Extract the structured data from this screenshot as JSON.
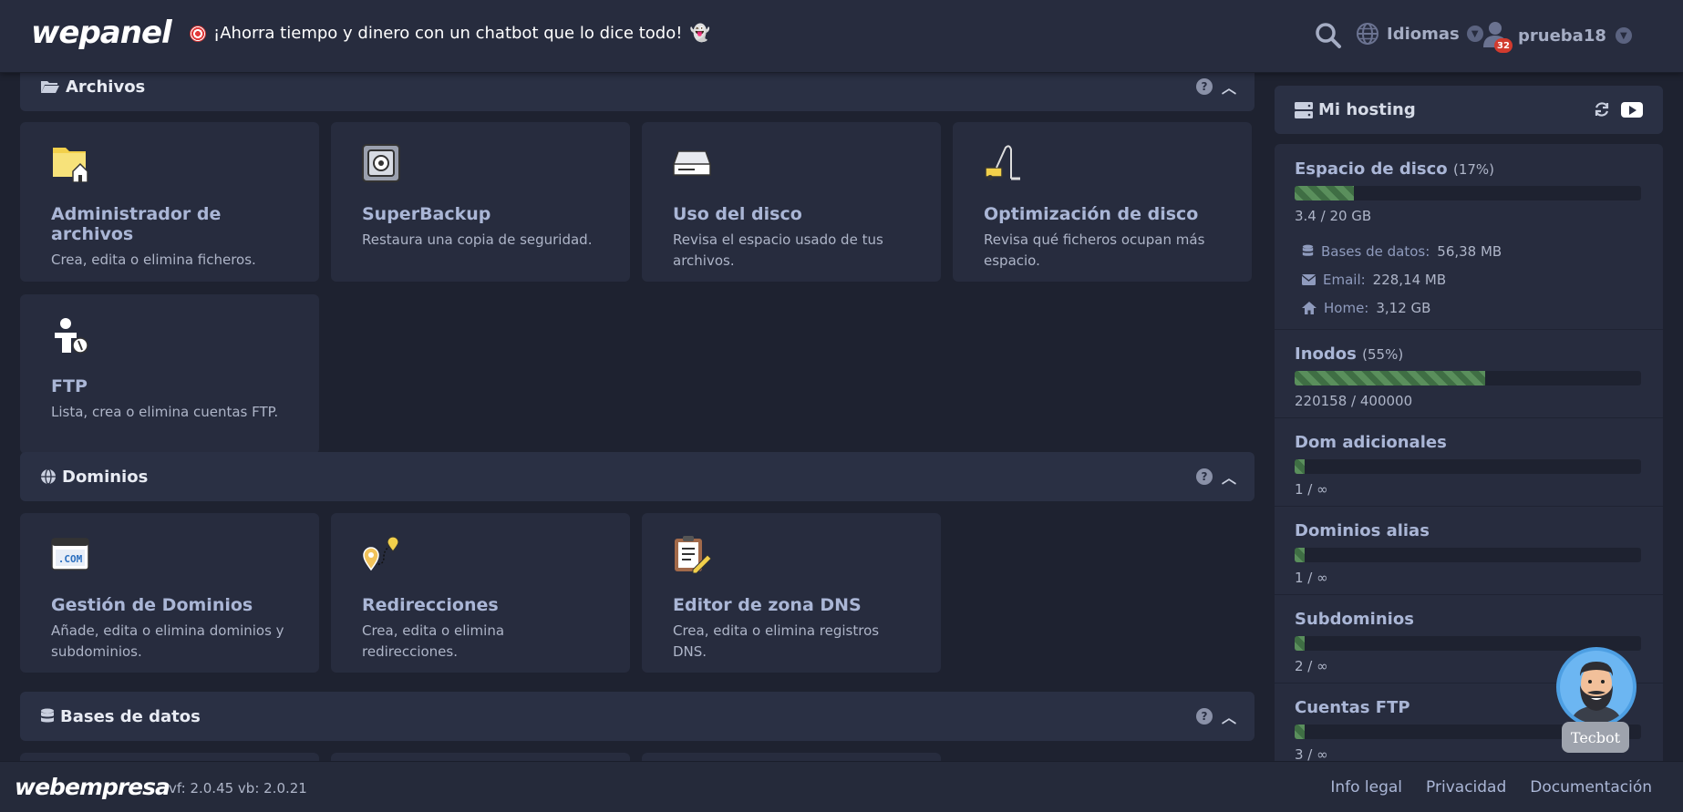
{
  "topbar": {
    "logo": "wepanel",
    "promo": "¡Ahorra tiempo y dinero con un chatbot que lo dice todo!",
    "languages_label": "Idiomas",
    "username": "prueba18",
    "notification_count": "32"
  },
  "sections": {
    "files": {
      "title": "Archivos",
      "cards": [
        {
          "title": "Administrador de archivos",
          "desc": "Crea, edita o elimina ficheros.",
          "icon": "folder-home-icon"
        },
        {
          "title": "SuperBackup",
          "desc": "Restaura una copia de seguridad.",
          "icon": "safe-icon"
        },
        {
          "title": "Uso del disco",
          "desc": "Revisa el espacio usado de tus archivos.",
          "icon": "hard-drive-icon"
        },
        {
          "title": "Optimización de disco",
          "desc": "Revisa qué ficheros ocupan más espacio.",
          "icon": "vacuum-icon"
        },
        {
          "title": "FTP",
          "desc": "Lista, crea o elimina cuentas FTP.",
          "icon": "ftp-user-icon"
        }
      ]
    },
    "domains": {
      "title": "Dominios",
      "cards": [
        {
          "title": "Gestión de Dominios",
          "desc": "Añade, edita o elimina dominios y subdominios.",
          "icon": "dotcom-icon",
          "icon_text": ".COM"
        },
        {
          "title": "Redirecciones",
          "desc": "Crea, edita o elimina redirecciones.",
          "icon": "route-pins-icon"
        },
        {
          "title": "Editor de zona DNS",
          "desc": "Crea, edita o elimina registros DNS.",
          "icon": "clipboard-edit-icon"
        }
      ]
    },
    "databases": {
      "title": "Bases de datos"
    }
  },
  "hosting": {
    "title": "Mi hosting",
    "stats": [
      {
        "title": "Espacio de disco",
        "pct": "(17%)",
        "fill": 0.17,
        "value": "3.4 / 20 GB"
      },
      {
        "title": "Inodos",
        "pct": "(55%)",
        "fill": 0.55,
        "value": "220158 / 400000"
      },
      {
        "title": "Dom adicionales",
        "pct": "",
        "fill": 0.03,
        "value": "1 / ∞"
      },
      {
        "title": "Dominios alias",
        "pct": "",
        "fill": 0.03,
        "value": "1 / ∞"
      },
      {
        "title": "Subdominios",
        "pct": "",
        "fill": 0.03,
        "value": "2 / ∞"
      },
      {
        "title": "Cuentas FTP",
        "pct": "",
        "fill": 0.03,
        "value": "3 / ∞"
      }
    ],
    "disk_breakdown": [
      {
        "label": "Bases de datos:",
        "value": "56,38 MB",
        "icon": "database-icon"
      },
      {
        "label": "Email:",
        "value": "228,14 MB",
        "icon": "envelope-icon"
      },
      {
        "label": "Home:",
        "value": "3,12 GB",
        "icon": "home-icon"
      }
    ]
  },
  "footer": {
    "logo": "webempresa",
    "version": "vf: 2.0.45 vb: 2.0.21",
    "links": [
      "Info legal",
      "Privacidad",
      "Documentación"
    ]
  },
  "tecbot": {
    "label": "Tecbot"
  },
  "colors": {
    "background": "#1e2230",
    "panel": "#272c3e",
    "header": "#2a3044",
    "progress": "#5a8f5c"
  }
}
